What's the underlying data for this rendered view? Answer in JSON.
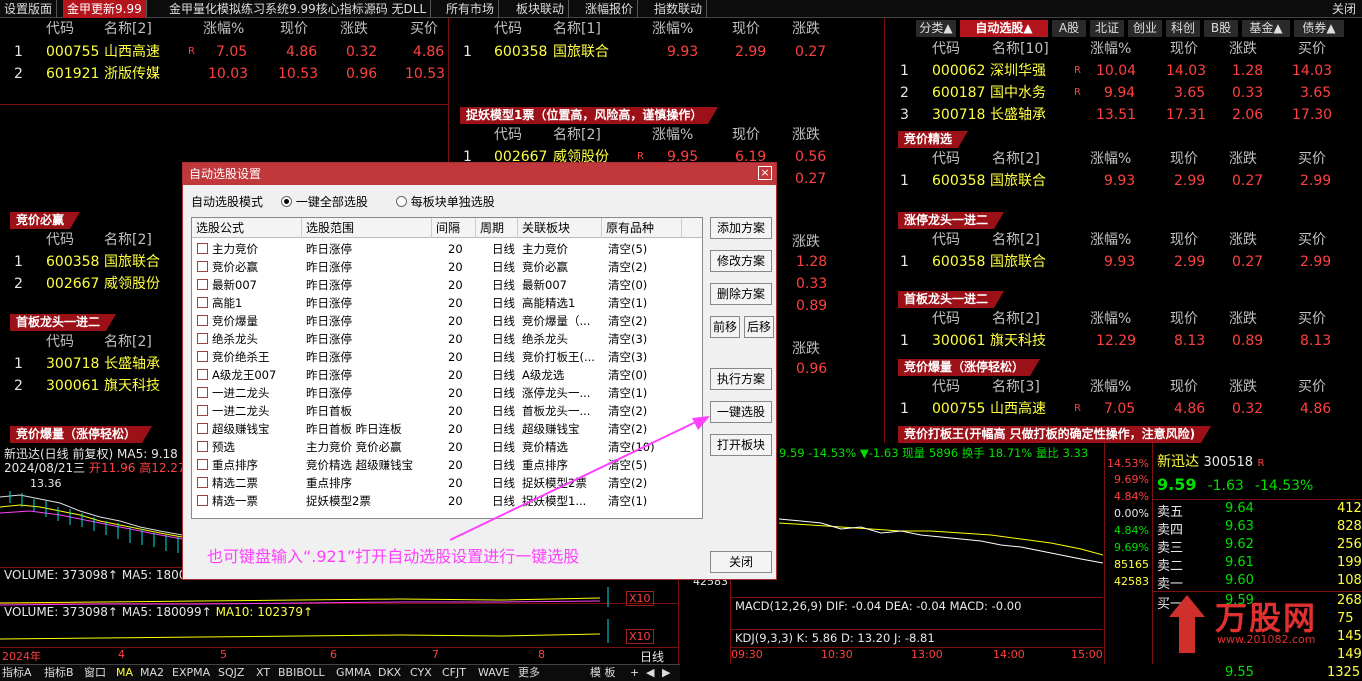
{
  "topbar": {
    "tabs": [
      "设置版面",
      "金甲更新9.99",
      "金甲量化模拟练习系统9.99核心指标源码 无DLL",
      "所有市场",
      "板块联动",
      "涨幅报价",
      "指数联动"
    ],
    "close": "关闭"
  },
  "headers": {
    "code": "代码",
    "name2": "名称[2]",
    "name1": "名称[1]",
    "name3": "名称[3]",
    "name10": "名称[10]",
    "pct": "涨幅%",
    "price": "现价",
    "change": "涨跌",
    "bid": "买价"
  },
  "panel_tl": {
    "rows": [
      {
        "n": "1",
        "code": "000755",
        "name": "山西高速",
        "flag": "R",
        "pct": "7.05",
        "price": "4.86",
        "chg": "0.32",
        "bid": "4.86"
      },
      {
        "n": "2",
        "code": "601921",
        "name": "浙版传媒",
        "flag": "",
        "pct": "10.03",
        "price": "10.53",
        "chg": "0.96",
        "bid": "10.53"
      }
    ]
  },
  "panel_tm": {
    "rows": [
      {
        "n": "1",
        "code": "600358",
        "name": "国旅联合",
        "pct": "9.93",
        "price": "2.99",
        "chg": "0.27"
      }
    ]
  },
  "panel_tm2": {
    "title": "捉妖模型1票（位置高，风险高，谨慎操作）",
    "rows": [
      {
        "n": "1",
        "code": "002667",
        "name": "威领股份",
        "flag": "R",
        "pct": "9.95",
        "price": "6.19",
        "chg": "0.56"
      }
    ],
    "extra_chg": "0.27"
  },
  "panel_l2": {
    "title": "竞价必赢",
    "rows": [
      {
        "n": "1",
        "code": "600358",
        "name": "国旅联合"
      },
      {
        "n": "2",
        "code": "002667",
        "name": "威领股份"
      }
    ],
    "right_vals": [
      "1.28",
      "0.33",
      "0.89"
    ]
  },
  "panel_l3": {
    "title": "首板龙头一进二",
    "rows": [
      {
        "n": "1",
        "code": "300718",
        "name": "长盛轴承"
      },
      {
        "n": "2",
        "code": "300061",
        "name": "旗天科技"
      }
    ],
    "right_vals": [
      "0.96"
    ]
  },
  "panel_l4": {
    "title": "竞价爆量（涨停轻松）"
  },
  "right_tabs": [
    "分类▲",
    "自动选股▲",
    "A股",
    "北证",
    "创业",
    "科创",
    "B股",
    "基金▲",
    "债券▲"
  ],
  "panel_r1": {
    "rows": [
      {
        "n": "1",
        "code": "000062",
        "name": "深圳华强",
        "flag": "R",
        "pct": "10.04",
        "price": "14.03",
        "chg": "1.28",
        "bid": "14.03"
      },
      {
        "n": "2",
        "code": "600187",
        "name": "国中水务",
        "flag": "R",
        "pct": "9.94",
        "price": "3.65",
        "chg": "0.33",
        "bid": "3.65"
      },
      {
        "n": "3",
        "code": "300718",
        "name": "长盛轴承",
        "flag": "",
        "pct": "13.51",
        "price": "17.31",
        "chg": "2.06",
        "bid": "17.30"
      }
    ]
  },
  "panel_r2": {
    "title": "竞价精选",
    "rows": [
      {
        "n": "1",
        "code": "600358",
        "name": "国旅联合",
        "pct": "9.93",
        "price": "2.99",
        "chg": "0.27",
        "bid": "2.99"
      }
    ]
  },
  "panel_r3": {
    "title": "涨停龙头一进二",
    "rows": [
      {
        "n": "1",
        "code": "600358",
        "name": "国旅联合",
        "pct": "9.93",
        "price": "2.99",
        "chg": "0.27",
        "bid": "2.99"
      }
    ]
  },
  "panel_r4": {
    "title": "首板龙头一进二",
    "rows": [
      {
        "n": "1",
        "code": "300061",
        "name": "旗天科技",
        "pct": "12.29",
        "price": "8.13",
        "chg": "0.89",
        "bid": "8.13"
      }
    ]
  },
  "panel_r5": {
    "title": "竞价爆量（涨停轻松）",
    "rows": [
      {
        "n": "1",
        "code": "000755",
        "name": "山西高速",
        "flag": "R",
        "pct": "7.05",
        "price": "4.86",
        "chg": "0.32",
        "bid": "4.86"
      }
    ]
  },
  "panel_r6": {
    "title": "竞价打板王(开幅高 只做打板的确定性操作，注意风险)"
  },
  "kline": {
    "title": "新迅达(日线 前复权)",
    "ma5": "MA5: 9.18",
    "date": "2024/08/21三",
    "open": "开11.96",
    "high": "高12.27",
    "low": "低",
    "price_label": "13.36",
    "vol1": "VOLUME: 373098↑",
    "vol1_ma5": "MA5: 1800",
    "vol2": "VOLUME: 373098↑",
    "vol2_ma5": "MA5: 180099↑",
    "vol2_ma10": "MA10: 102379↑",
    "x10a": "X10",
    "x10b": "X10",
    "years": [
      "2024年",
      "4",
      "5",
      "6",
      "7",
      "8"
    ],
    "period": "日线"
  },
  "intraday": {
    "header": "9.59 -14.53% ▼-1.63 现量 5896 换手 18.71% 量比 3.33",
    "yaxis": [
      "14.53%",
      "9.69%",
      "4.84%",
      "0.00%",
      "4.84%",
      "9.69%",
      "85165",
      "42583"
    ],
    "macd": "MACD(12,26,9) DIF: -0.04 DEA: -0.04 MACD: -0.00",
    "kdj": "KDJ(9,3,3) K: 5.86 D: 13.20 J: -8.81",
    "times": [
      "09:30",
      "10:30",
      "13:00",
      "14:00",
      "15:00"
    ],
    "vol_label": "42583"
  },
  "quote": {
    "name": "新迅达",
    "code": "300518",
    "flag": "R",
    "price": "9.59",
    "chg": "-1.63",
    "pct": "-14.53%",
    "asks": [
      {
        "label": "卖五",
        "price": "9.64",
        "vol": "412"
      },
      {
        "label": "卖四",
        "price": "9.63",
        "vol": "828"
      },
      {
        "label": "卖三",
        "price": "9.62",
        "vol": "256"
      },
      {
        "label": "卖二",
        "price": "9.61",
        "vol": "199"
      },
      {
        "label": "卖一",
        "price": "9.60",
        "vol": "108"
      }
    ],
    "bids": [
      {
        "label": "买一",
        "price": "9.59",
        "vol": "268"
      },
      {
        "label": "",
        "price": "",
        "vol": "75"
      },
      {
        "label": "",
        "price": "",
        "vol": "145"
      },
      {
        "label": "",
        "price": "",
        "vol": "149"
      },
      {
        "label": "",
        "price": "9.55",
        "vol": "1325"
      }
    ]
  },
  "watermark": "万股网",
  "watermark_url": "www.201082.com",
  "botbar": [
    "指标A",
    "指标B",
    "窗口",
    "MA",
    "MA2",
    "EXPMA",
    "SQJZ",
    "XT",
    "BBIBOLL",
    "GMMA",
    "DKX",
    "CYX",
    "CFJT",
    "WAVE",
    "更多",
    "模 板",
    "+",
    "◀",
    "▶"
  ],
  "dialog": {
    "title": "自动选股设置",
    "close": "×",
    "mode_label": "自动选股模式",
    "opt1": "一键全部选股",
    "opt2": "每板块单独选股",
    "columns": [
      "选股公式",
      "选股范围",
      "间隔",
      "周期",
      "关联板块",
      "原有品种"
    ],
    "rows": [
      [
        "主力竞价",
        "昨日涨停",
        "20",
        "日线",
        "主力竞价",
        "清空(5)"
      ],
      [
        "竞价必赢",
        "昨日涨停",
        "20",
        "日线",
        "竞价必赢",
        "清空(2)"
      ],
      [
        "最新007",
        "昨日涨停",
        "20",
        "日线",
        "最新007",
        "清空(0)"
      ],
      [
        "高能1",
        "昨日涨停",
        "20",
        "日线",
        "高能精选1",
        "清空(1)"
      ],
      [
        "竞价爆量",
        "昨日涨停",
        "20",
        "日线",
        "竞价爆量（...",
        "清空(2)"
      ],
      [
        "绝杀龙头",
        "昨日涨停",
        "20",
        "日线",
        "绝杀龙头",
        "清空(3)"
      ],
      [
        "竞价绝杀王",
        "昨日涨停",
        "20",
        "日线",
        "竞价打板王(...",
        "清空(3)"
      ],
      [
        "A级龙王007",
        "昨日涨停",
        "20",
        "日线",
        "A级龙选",
        "清空(0)"
      ],
      [
        "一进二龙头",
        "昨日涨停",
        "20",
        "日线",
        "涨停龙头一...",
        "清空(1)"
      ],
      [
        "一进二龙头",
        "昨日首板",
        "20",
        "日线",
        "首板龙头一...",
        "清空(2)"
      ],
      [
        "超级赚钱宝",
        "昨日首板 昨日连板",
        "20",
        "日线",
        "超级赚钱宝",
        "清空(2)"
      ],
      [
        "预选",
        "主力竞价 竞价必赢",
        "20",
        "日线",
        "竞价精选",
        "清空(10)"
      ],
      [
        "重点排序",
        "竞价精选 超级赚钱宝",
        "20",
        "日线",
        "重点排序",
        "清空(5)"
      ],
      [
        "精选二票",
        "重点排序",
        "20",
        "日线",
        "捉妖模型2票",
        "清空(2)"
      ],
      [
        "精选一票",
        "捉妖模型2票",
        "20",
        "日线",
        "捉妖模型1...",
        "清空(1)"
      ]
    ],
    "buttons": {
      "add": "添加方案",
      "edit": "修改方案",
      "del": "删除方案",
      "up": "前移",
      "down": "后移",
      "exec": "执行方案",
      "onekey": "一键选股",
      "open": "打开板块",
      "close": "关闭"
    },
    "annotation": "也可键盘输入“.921”打开自动选股设置进行一键选股"
  }
}
